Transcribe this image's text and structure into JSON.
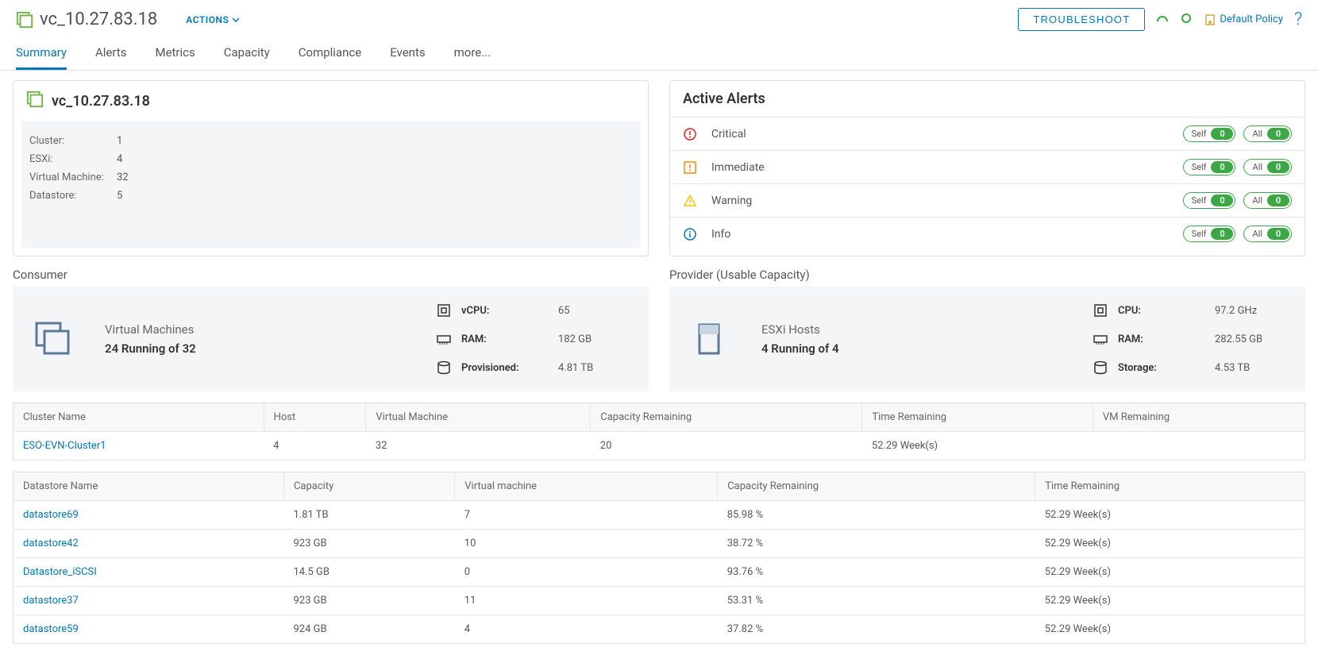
{
  "header": {
    "title": "vc_10.27.83.18",
    "actions_label": "ACTIONS",
    "troubleshoot_label": "TROUBLESHOOT",
    "default_policy_label": "Default Policy"
  },
  "tabs": [
    "Summary",
    "Alerts",
    "Metrics",
    "Capacity",
    "Compliance",
    "Events",
    "more..."
  ],
  "active_tab": "Summary",
  "summary_card": {
    "title": "vc_10.27.83.18",
    "items": [
      {
        "label": "Cluster:",
        "value": "1"
      },
      {
        "label": "ESXi:",
        "value": "4"
      },
      {
        "label": "Virtual Machine:",
        "value": "32"
      },
      {
        "label": "Datastore:",
        "value": "5"
      }
    ]
  },
  "active_alerts": {
    "title": "Active Alerts",
    "self_label": "Self",
    "all_label": "All",
    "levels": [
      {
        "name": "Critical",
        "self": 0,
        "all": 0,
        "color": "#e02020",
        "type": "circle-exclaim"
      },
      {
        "name": "Immediate",
        "self": 0,
        "all": 0,
        "color": "#f58b00",
        "type": "square-exclaim"
      },
      {
        "name": "Warning",
        "self": 0,
        "all": 0,
        "color": "#f5c400",
        "type": "triangle"
      },
      {
        "name": "Info",
        "self": 0,
        "all": 0,
        "color": "#0079b8",
        "type": "circle-i"
      }
    ]
  },
  "consumer": {
    "section_title": "Consumer",
    "main_label": "Virtual Machines",
    "main_value": "24 Running of 32",
    "metrics": [
      {
        "label": "vCPU:",
        "value": "65"
      },
      {
        "label": "RAM:",
        "value": "182 GB"
      },
      {
        "label": "Provisioned:",
        "value": "4.81 TB"
      }
    ]
  },
  "provider": {
    "section_title": "Provider (Usable Capacity)",
    "main_label": "ESXi Hosts",
    "main_value": "4 Running of 4",
    "metrics": [
      {
        "label": "CPU:",
        "value": "97.2 GHz"
      },
      {
        "label": "RAM:",
        "value": "282.55 GB"
      },
      {
        "label": "Storage:",
        "value": "4.53 TB"
      }
    ]
  },
  "cluster_table": {
    "headers": [
      "Cluster Name",
      "Host",
      "Virtual Machine",
      "Capacity Remaining",
      "Time Remaining",
      "VM Remaining"
    ],
    "rows": [
      {
        "name": "ESO-EVN-Cluster1",
        "host": "4",
        "vm": "32",
        "cap": "20",
        "time": "52.29 Week(s)",
        "vmrem": ""
      }
    ]
  },
  "datastore_table": {
    "headers": [
      "Datastore Name",
      "Capacity",
      "Virtual machine",
      "Capacity Remaining",
      "Time Remaining"
    ],
    "rows": [
      {
        "name": "datastore69",
        "cap": "1.81 TB",
        "vm": "7",
        "caprem": "85.98 %",
        "time": "52.29 Week(s)"
      },
      {
        "name": "datastore42",
        "cap": "923 GB",
        "vm": "10",
        "caprem": "38.72 %",
        "time": "52.29 Week(s)"
      },
      {
        "name": "Datastore_iSCSI",
        "cap": "14.5 GB",
        "vm": "0",
        "caprem": "93.76 %",
        "time": "52.29 Week(s)"
      },
      {
        "name": "datastore37",
        "cap": "923 GB",
        "vm": "11",
        "caprem": "53.31 %",
        "time": "52.29 Week(s)"
      },
      {
        "name": "datastore59",
        "cap": "924 GB",
        "vm": "4",
        "caprem": "37.82 %",
        "time": "52.29 Week(s)"
      }
    ]
  }
}
